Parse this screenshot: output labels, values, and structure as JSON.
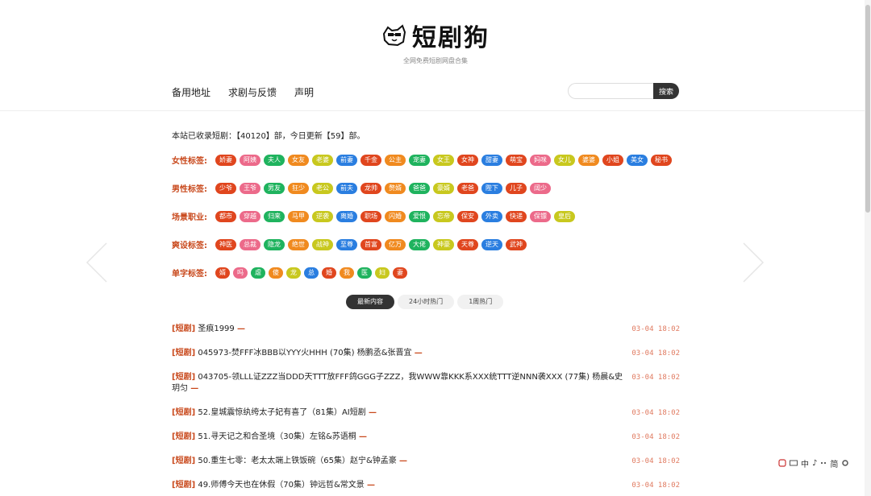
{
  "site": {
    "logo_text": "短剧狗",
    "subtitle": "全网免费短剧网盘合集"
  },
  "nav": {
    "links": [
      "备用地址",
      "求剧与反馈",
      "声明"
    ],
    "search_placeholder": "",
    "search_button": "搜索"
  },
  "stats": "本站已收录短剧：【40120】部，今日更新【59】部。",
  "tag_groups": [
    {
      "label": "女性标签:",
      "tags": [
        {
          "text": "娇妻",
          "color": "#e0461e"
        },
        {
          "text": "阿姨",
          "color": "#ec6a8a"
        },
        {
          "text": "夫人",
          "color": "#1fb35e"
        },
        {
          "text": "女友",
          "color": "#f08a1f"
        },
        {
          "text": "老婆",
          "color": "#c8c81e"
        },
        {
          "text": "前妻",
          "color": "#2a7ee0"
        },
        {
          "text": "千金",
          "color": "#e0461e"
        },
        {
          "text": "公主",
          "color": "#f08a1f"
        },
        {
          "text": "宠妻",
          "color": "#1fb35e"
        },
        {
          "text": "女王",
          "color": "#c8c81e"
        },
        {
          "text": "女神",
          "color": "#e0461e"
        },
        {
          "text": "甜妻",
          "color": "#2a7ee0"
        },
        {
          "text": "萌宝",
          "color": "#e0461e"
        },
        {
          "text": "妈咪",
          "color": "#ec6a8a"
        },
        {
          "text": "女儿",
          "color": "#c8c81e"
        },
        {
          "text": "婆婆",
          "color": "#f08a1f"
        },
        {
          "text": "小姐",
          "color": "#e0461e"
        },
        {
          "text": "美女",
          "color": "#2a7ee0"
        },
        {
          "text": "秘书",
          "color": "#e0461e"
        }
      ]
    },
    {
      "label": "男性标签:",
      "tags": [
        {
          "text": "少爷",
          "color": "#e0461e"
        },
        {
          "text": "王爷",
          "color": "#ec6a8a"
        },
        {
          "text": "男友",
          "color": "#1fb35e"
        },
        {
          "text": "狂少",
          "color": "#f08a1f"
        },
        {
          "text": "老公",
          "color": "#c8c81e"
        },
        {
          "text": "前夫",
          "color": "#2a7ee0"
        },
        {
          "text": "龙帅",
          "color": "#e0461e"
        },
        {
          "text": "赘婿",
          "color": "#f08a1f"
        },
        {
          "text": "爸爸",
          "color": "#1fb35e"
        },
        {
          "text": "豪婿",
          "color": "#c8c81e"
        },
        {
          "text": "老爸",
          "color": "#e0461e"
        },
        {
          "text": "陛下",
          "color": "#2a7ee0"
        },
        {
          "text": "儿子",
          "color": "#e0461e"
        },
        {
          "text": "阔少",
          "color": "#ec6a8a"
        }
      ]
    },
    {
      "label": "场景职业:",
      "tags": [
        {
          "text": "都市",
          "color": "#e0461e"
        },
        {
          "text": "穿越",
          "color": "#ec6a8a"
        },
        {
          "text": "归来",
          "color": "#1fb35e"
        },
        {
          "text": "马甲",
          "color": "#f08a1f"
        },
        {
          "text": "逆袭",
          "color": "#c8c81e"
        },
        {
          "text": "离婚",
          "color": "#2a7ee0"
        },
        {
          "text": "职场",
          "color": "#e0461e"
        },
        {
          "text": "闪婚",
          "color": "#f08a1f"
        },
        {
          "text": "爱恨",
          "color": "#1fb35e"
        },
        {
          "text": "忘帝",
          "color": "#c8c81e"
        },
        {
          "text": "保安",
          "color": "#e0461e"
        },
        {
          "text": "外卖",
          "color": "#2a7ee0"
        },
        {
          "text": "快递",
          "color": "#e0461e"
        },
        {
          "text": "保镖",
          "color": "#ec6a8a"
        },
        {
          "text": "皇后",
          "color": "#c8c81e"
        }
      ]
    },
    {
      "label": "爽设标签:",
      "tags": [
        {
          "text": "神医",
          "color": "#e0461e"
        },
        {
          "text": "总裁",
          "color": "#ec6a8a"
        },
        {
          "text": "隐龙",
          "color": "#1fb35e"
        },
        {
          "text": "绝世",
          "color": "#f08a1f"
        },
        {
          "text": "战神",
          "color": "#c8c81e"
        },
        {
          "text": "至尊",
          "color": "#2a7ee0"
        },
        {
          "text": "首富",
          "color": "#e0461e"
        },
        {
          "text": "亿万",
          "color": "#f08a1f"
        },
        {
          "text": "大佬",
          "color": "#1fb35e"
        },
        {
          "text": "神豪",
          "color": "#c8c81e"
        },
        {
          "text": "天尊",
          "color": "#e0461e"
        },
        {
          "text": "逆天",
          "color": "#2a7ee0"
        },
        {
          "text": "武神",
          "color": "#e0461e"
        }
      ]
    },
    {
      "label": "单字标签:",
      "tags": [
        {
          "text": "婿",
          "color": "#e0461e"
        },
        {
          "text": "吗",
          "color": "#ec6a8a"
        },
        {
          "text": "虐",
          "color": "#1fb35e"
        },
        {
          "text": "傻",
          "color": "#f08a1f"
        },
        {
          "text": "龙",
          "color": "#c8c81e"
        },
        {
          "text": "总",
          "color": "#2a7ee0"
        },
        {
          "text": "婚",
          "color": "#e0461e"
        },
        {
          "text": "我",
          "color": "#f08a1f"
        },
        {
          "text": "医",
          "color": "#1fb35e"
        },
        {
          "text": "妇",
          "color": "#c8c81e"
        },
        {
          "text": "妻",
          "color": "#e0461e"
        }
      ]
    }
  ],
  "tabs": [
    "最新内容",
    "24小时热门",
    "1周热门"
  ],
  "items": [
    {
      "tag": "[短剧]",
      "title": "圣痕1999",
      "time": "03-04 18:02"
    },
    {
      "tag": "[短剧]",
      "title": "045973-焚FFF冰BBB以YYY火HHH (70集) 杨鹏丞&张晋宜",
      "time": "03-04 18:02"
    },
    {
      "tag": "[短剧]",
      "title": "043705-领LLL证ZZZ当DDD天TTT放FFF鸽GGG子ZZZ，我WWW靠KKK系XXX统TTT逆NNN袭XXX (77集) 杨晨&史玥匀",
      "time": "03-04 18:02"
    },
    {
      "tag": "[短剧]",
      "title": "52.皇城震惊纨绔太子妃有喜了（81集）AI短剧",
      "time": "03-04 18:02"
    },
    {
      "tag": "[短剧]",
      "title": "51.寻天记之和合圣境（30集）左铭&苏语桐",
      "time": "03-04 18:02"
    },
    {
      "tag": "[短剧]",
      "title": "50.重生七零：老太太端上铁饭碗（65集）赵宁&钟孟豪",
      "time": "03-04 18:02"
    },
    {
      "tag": "[短剧]",
      "title": "49.师傅今天也在休假（70集）钟远哲&常文景",
      "time": "03-04 18:02"
    }
  ],
  "ime": [
    "中",
    "♪",
    "简"
  ]
}
